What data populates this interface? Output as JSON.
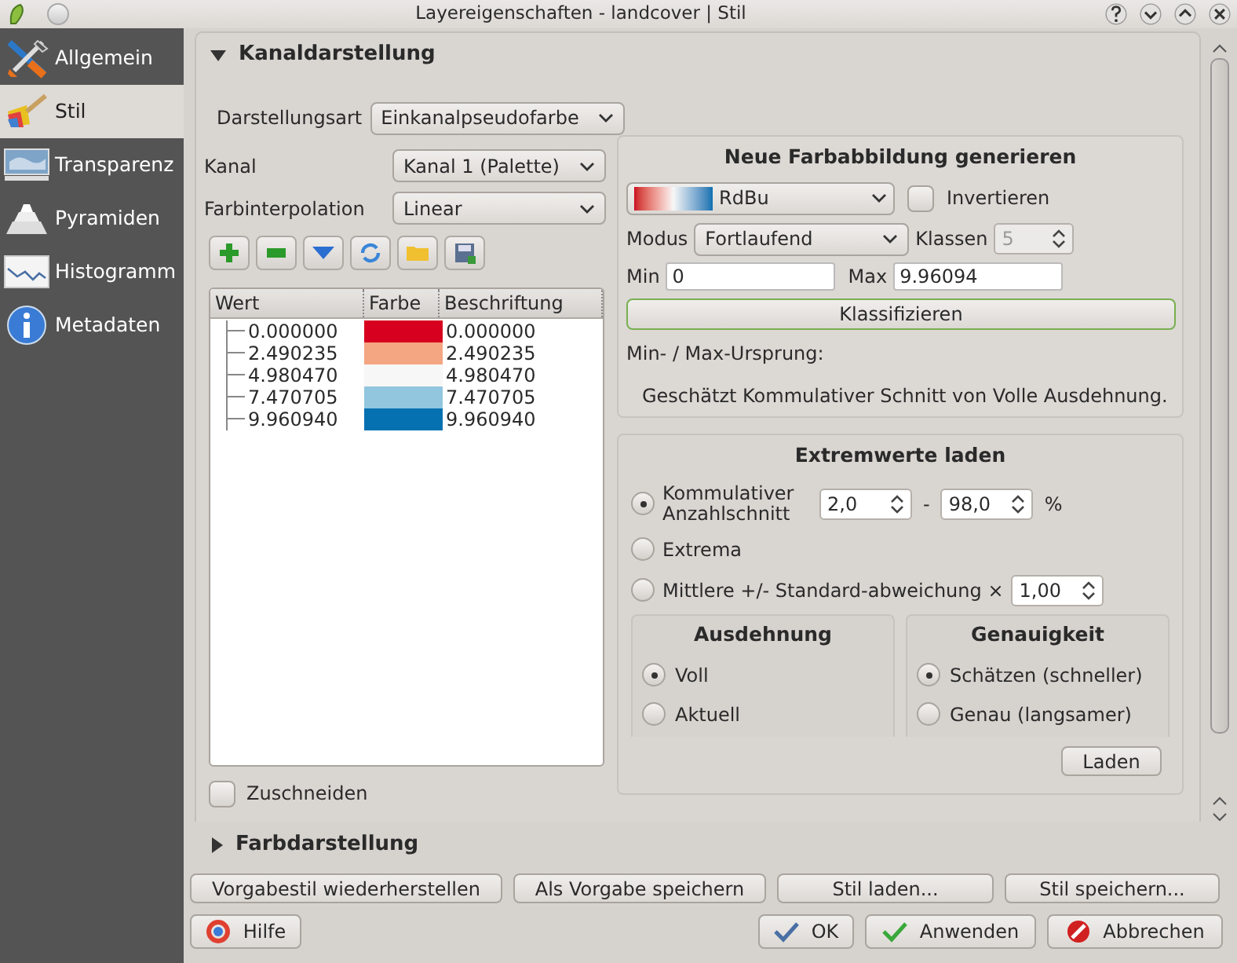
{
  "window": {
    "title": "Layereigenschaften - landcover | Stil"
  },
  "sidebar": {
    "items": [
      {
        "label": "Allgemein",
        "selected": false
      },
      {
        "label": "Stil",
        "selected": true
      },
      {
        "label": "Transparenz",
        "selected": false
      },
      {
        "label": "Pyramiden",
        "selected": false
      },
      {
        "label": "Histogramm",
        "selected": false
      },
      {
        "label": "Metadaten",
        "selected": false
      }
    ]
  },
  "band_rendering": {
    "title": "Kanaldarstellung",
    "expanded": true,
    "render_type": {
      "label": "Darstellungsart",
      "value": "Einkanalpseudofarbe"
    },
    "band": {
      "label": "Kanal",
      "value": "Kanal 1 (Palette)"
    },
    "interpolation": {
      "label": "Farbinterpolation",
      "value": "Linear"
    },
    "table": {
      "columns": [
        "Wert",
        "Farbe",
        "Beschriftung"
      ],
      "rows": [
        {
          "value": "0.000000",
          "color": "#d7001f",
          "label": "0.000000"
        },
        {
          "value": "2.490235",
          "color": "#f4a582",
          "label": "2.490235"
        },
        {
          "value": "4.980470",
          "color": "#f7f7f7",
          "label": "4.980470"
        },
        {
          "value": "7.470705",
          "color": "#92c5de",
          "label": "7.470705"
        },
        {
          "value": "9.960940",
          "color": "#0571b0",
          "label": "9.960940"
        }
      ]
    },
    "clip": {
      "label": "Zuschneiden",
      "checked": false
    },
    "generate": {
      "title": "Neue Farbabbildung generieren",
      "ramp": "RdBu",
      "invert": {
        "label": "Invertieren",
        "checked": false
      },
      "mode": {
        "label": "Modus",
        "value": "Fortlaufend"
      },
      "classes": {
        "label": "Klassen",
        "value": "5",
        "disabled": true
      },
      "min": {
        "label": "Min",
        "value": "0"
      },
      "max": {
        "label": "Max",
        "value": "9.96094"
      },
      "classify_button": "Klassifizieren",
      "origin_label": "Min- / Max-Ursprung:",
      "origin_text": "Geschätzt Kommulativer Schnitt von Volle Ausdehnung."
    },
    "load_minmax": {
      "title": "Extremwerte laden",
      "options": [
        {
          "kind": "cumulative",
          "label": "Kommulativer Anzahlschnitt",
          "selected": true,
          "from": "2,0",
          "separator": "-",
          "to": "98,0",
          "unit": "%"
        },
        {
          "kind": "plain",
          "label": "Extrema",
          "selected": false
        },
        {
          "kind": "stddev",
          "label": "Mittlere +/- Standard-abweichung ×",
          "selected": false,
          "factor": "1,00"
        }
      ],
      "extent": {
        "title": "Ausdehnung",
        "options": [
          {
            "label": "Voll",
            "selected": true
          },
          {
            "label": "Aktuell",
            "selected": false
          }
        ]
      },
      "accuracy": {
        "title": "Genauigkeit",
        "options": [
          {
            "label": "Schätzen (schneller)",
            "selected": true
          },
          {
            "label": "Genau (langsamer)",
            "selected": false
          }
        ]
      },
      "load_button": "Laden"
    }
  },
  "color_rendering": {
    "title": "Farbdarstellung",
    "expanded": false
  },
  "style_buttons": [
    "Vorgabestil wiederherstellen",
    "Als Vorgabe speichern",
    "Stil laden...",
    "Stil speichern..."
  ],
  "dialog_buttons": [
    {
      "kind": "help",
      "label": "Hilfe"
    },
    {
      "kind": "ok",
      "label": "OK"
    },
    {
      "kind": "apply",
      "label": "Anwenden"
    },
    {
      "kind": "cancel",
      "label": "Abbrechen"
    }
  ]
}
